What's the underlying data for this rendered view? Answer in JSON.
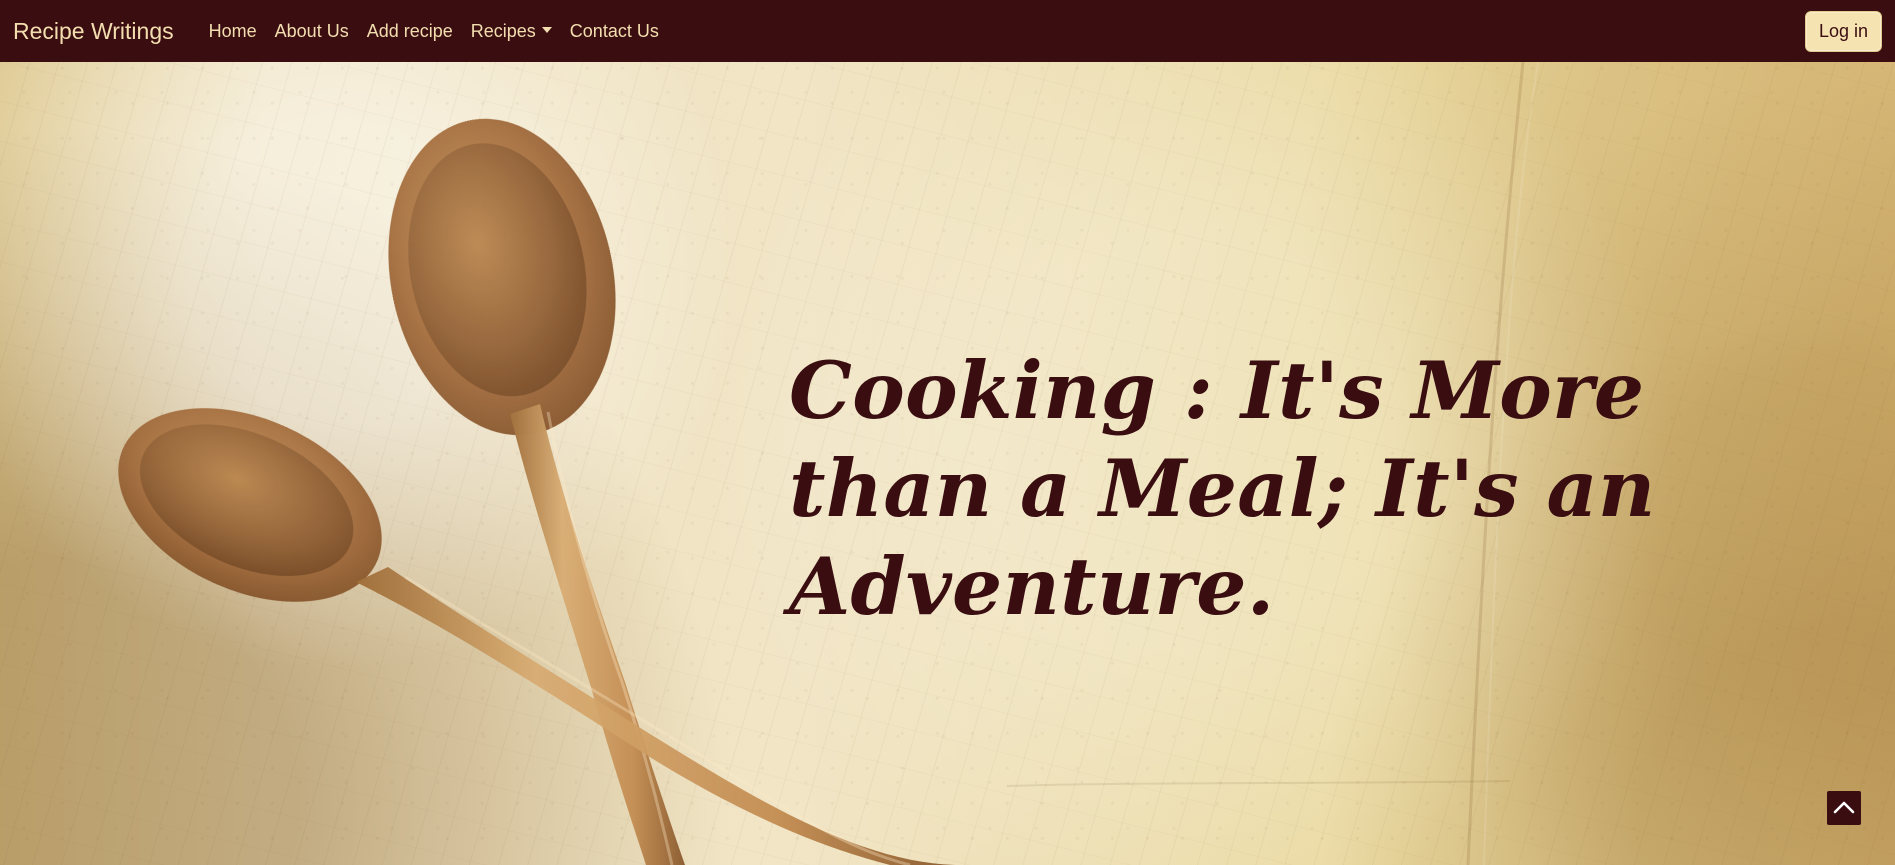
{
  "navbar": {
    "brand": "Recipe Writings",
    "links": [
      {
        "label": "Home"
      },
      {
        "label": "About Us"
      },
      {
        "label": "Add recipe"
      },
      {
        "label": "Recipes"
      },
      {
        "label": "Contact Us"
      }
    ],
    "login_label": "Log in"
  },
  "hero": {
    "heading": "Cooking : It's More than a Meal; It's an Adventure."
  },
  "icons": {
    "scroll_top": "chevron-up-icon",
    "dropdown": "caret-down-icon"
  },
  "colors": {
    "nav_background": "#3a0d10",
    "nav_text": "#f3deb0",
    "login_background": "#f6e3b2",
    "heading_text": "#3a0d10"
  }
}
